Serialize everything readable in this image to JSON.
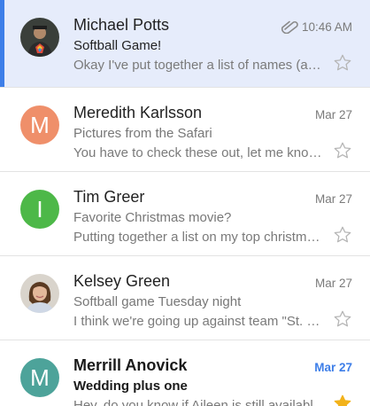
{
  "colors": {
    "selected_bg": "#e6ecfb",
    "selected_accent": "#3d7ee8",
    "avatar_orange": "#ef8f6a",
    "avatar_green": "#4db848",
    "avatar_teal": "#4da39a",
    "star_gold": "#f2b21a",
    "unread_time": "#3d7ee8"
  },
  "emails": [
    {
      "sender": "Michael Potts",
      "time": "10:46 AM",
      "subject": "Softball Game!",
      "snippet": "Okay I've put together a list of names (and...",
      "avatar": "photo-icon",
      "attachment": "paperclip-icon",
      "starred": false,
      "selected": true
    },
    {
      "sender": "Meredith Karlsson",
      "time": "Mar 27",
      "subject": "Pictures from the Safari",
      "snippet": "You have to check these out, let me know ...",
      "avatar_letter": "M",
      "starred": false
    },
    {
      "sender": "Tim Greer",
      "time": "Mar 27",
      "subject": "Favorite Christmas movie?",
      "snippet": "Putting together a list on my top christmas...",
      "avatar_letter": "I",
      "starred": false
    },
    {
      "sender": "Kelsey Green",
      "time": "Mar 27",
      "subject": "Softball game Tuesday night",
      "snippet": "I think we're going up against team \"St. El...",
      "avatar": "photo-icon",
      "starred": false
    },
    {
      "sender": "Merrill Anovick",
      "time": "Mar 27",
      "subject": "Wedding plus one",
      "snippet": "Hey, do you know if Aileen is still available...",
      "avatar_letter": "M",
      "starred": true,
      "unread": true
    }
  ]
}
